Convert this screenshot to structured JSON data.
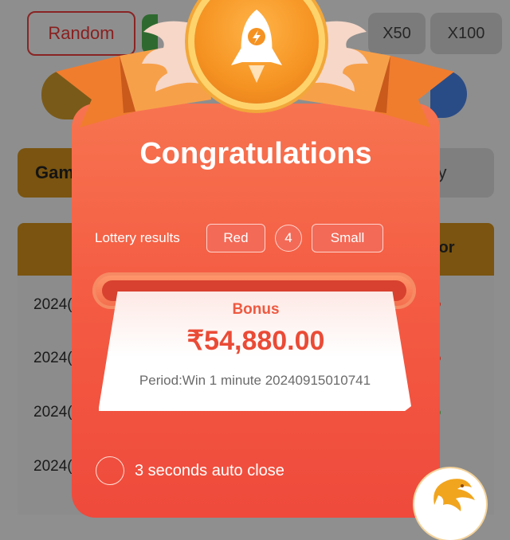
{
  "background": {
    "random_label": "Random",
    "multipliers": [
      "X50",
      "X100"
    ],
    "tab_game": "Gam",
    "tab_history": "ory",
    "table_header_right": "lor",
    "rows": [
      "2024(",
      "2024(",
      "2024(",
      "2024("
    ],
    "row_dot_colors": [
      "#b52a1f",
      "#b52a1f",
      "#2e7a35",
      "#b52a1f"
    ]
  },
  "modal": {
    "title": "Congratulations",
    "results_label": "Lottery results",
    "result_color": "Red",
    "result_number": "4",
    "result_size": "Small",
    "bonus_label": "Bonus",
    "bonus_amount": "₹54,880.00",
    "period": "Period:Win 1 minute 20240915010741",
    "auto_close": "3 seconds auto close"
  },
  "icons": {
    "medal": "rocket-icon",
    "logo": "dragon-logo-icon"
  },
  "colors": {
    "card_top": "#f77450",
    "card_bottom": "#ef4a3c",
    "amount": "#ea4b36",
    "medal": "#f59322"
  }
}
